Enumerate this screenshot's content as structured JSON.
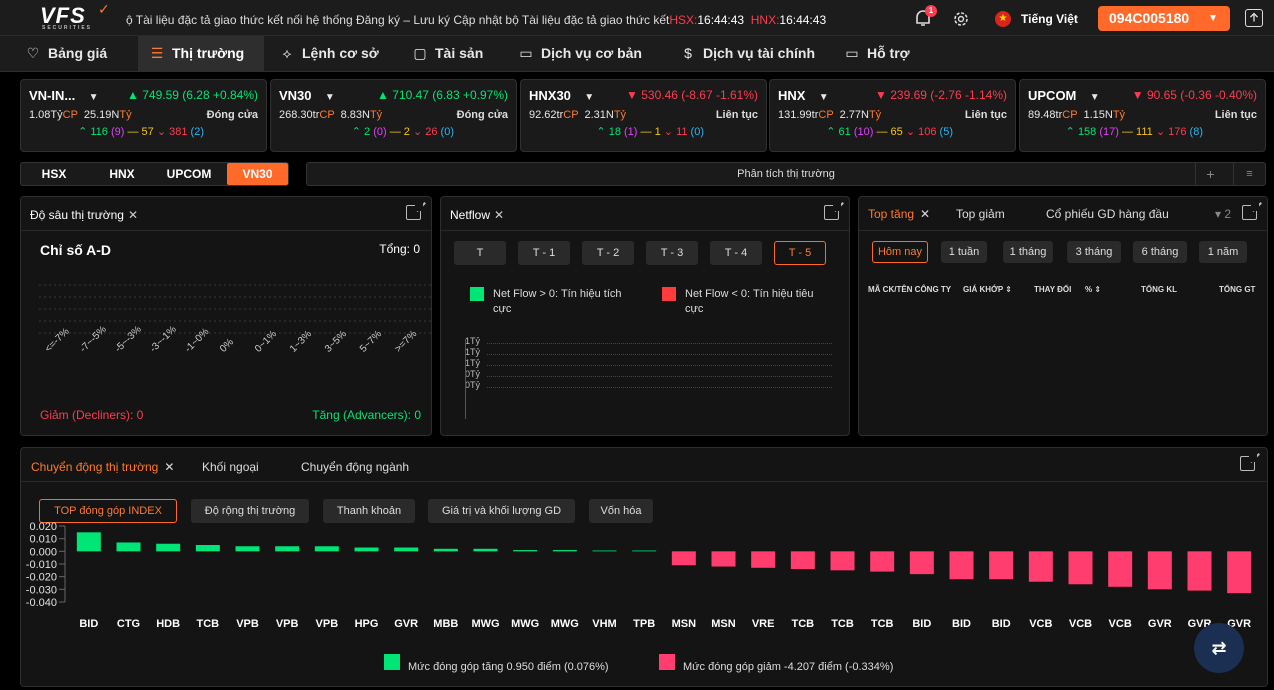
{
  "topbar": {
    "logo": "VFS",
    "logo_sub": "SECURITIES",
    "marquee_text": "ộ Tài liệu đặc tả giao thức kết nối hệ thống Đăng ký – Lưu ký  Cập nhật bộ Tài liệu đặc tả giao thức kết",
    "hsx_label": "HSX:",
    "hsx_time": "16:44:43",
    "hnx_label": "HNX:",
    "hnx_time": "16:44:43",
    "notification_count": "1",
    "language": "Tiếng Việt",
    "account": "094C005180"
  },
  "nav": [
    {
      "label": "Bảng giá",
      "icon": "heart-icon"
    },
    {
      "label": "Thị trường",
      "icon": "market-icon"
    },
    {
      "label": "Lệnh cơ sở",
      "icon": "order-icon"
    },
    {
      "label": "Tài sản",
      "icon": "asset-icon"
    },
    {
      "label": "Dịch vụ cơ bản",
      "icon": "service-icon"
    },
    {
      "label": "Dịch vụ tài chính",
      "icon": "finance-icon"
    },
    {
      "label": "Hỗ trợ",
      "icon": "support-icon"
    }
  ],
  "indices": [
    {
      "name": "VN-IN...",
      "value": "749.59 (6.28 +0.84%)",
      "dir": "up",
      "vol": "1.08Tỷ",
      "cp": "CP",
      "val": "25.19N",
      "unit": "Tỷ",
      "status": "Đóng cửa",
      "up": "116",
      "ceil": "(9)",
      "ref": "57",
      "down": "381",
      "floor": "(2)"
    },
    {
      "name": "VN30",
      "value": "710.47 (6.83 +0.97%)",
      "dir": "up",
      "vol": "268.30tr",
      "cp": "CP",
      "val": "8.83N",
      "unit": "Tỷ",
      "status": "Đóng cửa",
      "up": "2",
      "ceil": "(0)",
      "ref": "2",
      "down": "26",
      "floor": "(0)"
    },
    {
      "name": "HNX30",
      "value": "530.46 (-8.67 -1.61%)",
      "dir": "down",
      "vol": "92.62tr",
      "cp": "CP",
      "val": "2.31N",
      "unit": "Tỷ",
      "status": "Liên tục",
      "up": "18",
      "ceil": "(1)",
      "ref": "1",
      "down": "11",
      "floor": "(0)"
    },
    {
      "name": "HNX",
      "value": "239.69 (-2.76 -1.14%)",
      "dir": "down",
      "vol": "131.99tr",
      "cp": "CP",
      "val": "2.77N",
      "unit": "Tỷ",
      "status": "Liên tục",
      "up": "61",
      "ceil": "(10)",
      "ref": "65",
      "down": "106",
      "floor": "(5)"
    },
    {
      "name": "UPCOM",
      "value": "90.65 (-0.36 -0.40%)",
      "dir": "down",
      "vol": "89.48tr",
      "cp": "CP",
      "val": "1.15N",
      "unit": "Tỷ",
      "status": "Liên tục",
      "up": "158",
      "ceil": "(17)",
      "ref": "111",
      "down": "176",
      "floor": "(8)"
    }
  ],
  "market_tabs": [
    "HSX",
    "HNX",
    "UPCOM",
    "VN30"
  ],
  "analysis_label": "Phân tích thị trường",
  "depth": {
    "title": "Độ sâu thị trường",
    "heading": "Chỉ số A-D",
    "total": "Tổng: 0",
    "ticks": [
      "<=-7%",
      "-7~-5%",
      "-5~-3%",
      "-3~-1%",
      "-1~0%",
      "0%",
      "0~1%",
      "1~3%",
      "3~5%",
      "5~7%",
      ">=7%"
    ],
    "decliners": "Giảm (Decliners): 0",
    "advancers": "Tăng (Advancers): 0"
  },
  "netflow": {
    "title": "Netflow",
    "buttons": [
      "T",
      "T - 1",
      "T - 2",
      "T - 3",
      "T - 4",
      "T - 5"
    ],
    "pos_legend": "Net Flow > 0: Tín hiệu tích cực",
    "neg_legend": "Net Flow < 0: Tín hiệu tiêu cực",
    "yticks": [
      "1Tỷ",
      "1Tỷ",
      "1Tỷ",
      "0Tỷ",
      "0Tỷ"
    ],
    "pos_color": "#00e676",
    "neg_color": "#ff3b3b"
  },
  "top": {
    "tabs": [
      "Top tăng",
      "Top giảm",
      "Cổ phiếu GD hàng đầu"
    ],
    "overflow": "2",
    "periods": [
      "Hôm nay",
      "1 tuần",
      "1 tháng",
      "3 tháng",
      "6 tháng",
      "1 năm"
    ],
    "columns": [
      "MÃ CK/TÊN CÔNG TY",
      "GIÁ KHỚP",
      "THAY ĐỔI",
      "%",
      "TỔNG KL",
      "TỔNG GT"
    ]
  },
  "movement": {
    "tabs": [
      "Chuyển động thị trường",
      "Khối ngoại",
      "Chuyển động ngành"
    ],
    "buttons": [
      "TOP đóng góp INDEX",
      "Độ rộng thị trường",
      "Thanh khoản",
      "Giá trị và khối lượng GD",
      "Vốn hóa"
    ],
    "legend_pos": "Mức đóng góp tăng 0.950 điểm (0.076%)",
    "legend_neg": "Mức đóng góp giảm -4.207 điểm (-0.334%)",
    "pos_color": "#00e676",
    "neg_color": "#ff3d6e"
  },
  "chart_data": {
    "type": "bar",
    "categories": [
      "BID",
      "CTG",
      "HDB",
      "TCB",
      "VPB",
      "VPB",
      "VPB",
      "HPG",
      "GVR",
      "MBB",
      "MWG",
      "MWG",
      "MWG",
      "VHM",
      "TPB",
      "MSN",
      "MSN",
      "VRE",
      "TCB",
      "TCB",
      "TCB",
      "BID",
      "BID",
      "BID",
      "VCB",
      "VCB",
      "VCB",
      "GVR",
      "GVR",
      "GVR"
    ],
    "values": [
      0.015,
      0.007,
      0.006,
      0.005,
      0.004,
      0.004,
      0.004,
      0.003,
      0.003,
      0.002,
      0.002,
      0.001,
      0.001,
      0.0005,
      0.0002,
      -0.011,
      -0.012,
      -0.013,
      -0.014,
      -0.015,
      -0.016,
      -0.018,
      -0.022,
      -0.022,
      -0.024,
      -0.026,
      -0.028,
      -0.03,
      -0.031,
      -0.033
    ],
    "yticks": [
      "0.020",
      "0.010",
      "0.000",
      "-0.010",
      "-0.020",
      "-0.030",
      "-0.040"
    ],
    "ylim": [
      -0.04,
      0.02
    ]
  }
}
